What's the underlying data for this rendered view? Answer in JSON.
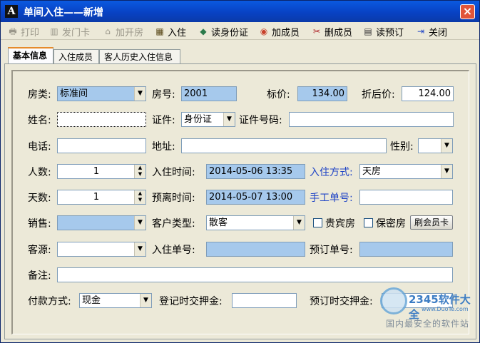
{
  "window": {
    "title": "单间入住——新增",
    "app_icon": "A",
    "close": "×"
  },
  "toolbar": [
    {
      "icon": "printer-icon",
      "glyph": "🖶",
      "label": "打印",
      "enabled": false
    },
    {
      "icon": "card-icon",
      "glyph": "▥",
      "label": "发门卡",
      "enabled": false
    },
    {
      "icon": "room-icon",
      "glyph": "⌂",
      "label": "加开房",
      "enabled": false
    },
    {
      "icon": "checkin-icon",
      "glyph": "▦",
      "label": "入住",
      "enabled": true
    },
    {
      "icon": "id-card-icon",
      "glyph": "◆",
      "label": "读身份证",
      "enabled": true
    },
    {
      "icon": "add-member-icon",
      "glyph": "◉",
      "label": "加成员",
      "enabled": true
    },
    {
      "icon": "delete-member-icon",
      "glyph": "✂",
      "label": "删成员",
      "enabled": true
    },
    {
      "icon": "reservation-icon",
      "glyph": "▤",
      "label": "读预订",
      "enabled": true
    },
    {
      "icon": "close-door-icon",
      "glyph": "⇥",
      "label": "关闭",
      "enabled": true
    }
  ],
  "tabs": [
    "基本信息",
    "入住成员",
    "客人历史入住信息"
  ],
  "form": {
    "room_type_label": "房类:",
    "room_type": "标准间",
    "room_no_label": "房号:",
    "room_no": "2001",
    "price_label": "标价:",
    "price": "134.00",
    "discount_price_label": "折后价:",
    "discount_price": "124.00",
    "name_label": "姓名:",
    "name": "",
    "id_type_label": "证件:",
    "id_type": "身份证",
    "id_no_label": "证件号码:",
    "id_no": "",
    "phone_label": "电话:",
    "phone": "",
    "address_label": "地址:",
    "address": "",
    "gender_label": "性别:",
    "gender": "",
    "persons_label": "人数:",
    "persons": "1",
    "checkin_time_label": "入住时间:",
    "checkin_time": "2014-05-06 13:35",
    "checkin_method_label": "入住方式:",
    "checkin_method": "天房",
    "days_label": "天数:",
    "days": "1",
    "checkout_time_label": "预离时间:",
    "checkout_time": "2014-05-07 13:00",
    "manual_no_label": "手工单号:",
    "manual_no": "",
    "sales_label": "销售:",
    "sales": "",
    "customer_type_label": "客户类型:",
    "customer_type": "散客",
    "vip_room_label": "贵宾房",
    "secret_room_label": "保密房",
    "swipe_card_label": "刷会员卡",
    "source_label": "客源:",
    "source": "",
    "checkin_no_label": "入住单号:",
    "checkin_no": "",
    "booking_no_label": "预订单号:",
    "booking_no": "",
    "remark_label": "备注:",
    "remark": "",
    "payment_label": "付款方式:",
    "payment": "现金",
    "deposit_label": "登记时交押金:",
    "deposit": "",
    "booking_deposit_label": "预订时交押金:",
    "booking_deposit": ""
  },
  "watermark": {
    "brand": "2345软件大全",
    "url": "www.DuoTe.com",
    "slogan": "国内最安全的软件站"
  }
}
